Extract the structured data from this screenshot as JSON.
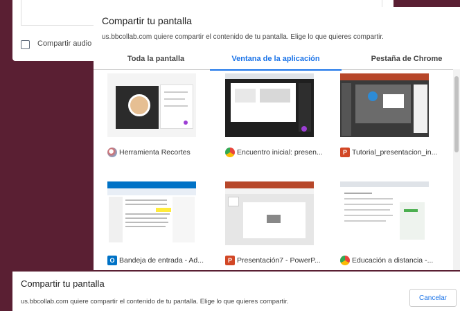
{
  "back_dialog": {
    "audio_label": "Compartir audio"
  },
  "picker": {
    "title": "Compartir tu pantalla",
    "subtitle": "us.bbcollab.com quiere compartir el contenido de tu pantalla. Elige lo que quieres compartir.",
    "tabs": [
      {
        "label": "Toda la pantalla",
        "active": false
      },
      {
        "label": "Ventana de la aplicación",
        "active": true
      },
      {
        "label": "Pestaña de Chrome",
        "active": false
      }
    ],
    "windows": [
      {
        "label": "Herramienta Recortes",
        "icon": "snipping-tool-icon",
        "icon_color": "#d46a6a"
      },
      {
        "label": "Encuentro inicial: presen...",
        "icon": "chrome-icon",
        "icon_color": "#e8453c"
      },
      {
        "label": "Tutorial_presentacion_in...",
        "icon": "powerpoint-icon",
        "icon_color": "#d24726"
      },
      {
        "label": "Bandeja de entrada - Ad...",
        "icon": "outlook-icon",
        "icon_color": "#0072c6"
      },
      {
        "label": "Presentación7 - PowerP...",
        "icon": "powerpoint-icon",
        "icon_color": "#d24726"
      },
      {
        "label": "Educación a distancia -...",
        "icon": "chrome-icon",
        "icon_color": "#e8453c"
      }
    ]
  },
  "bottom_bar": {
    "title": "Compartir tu pantalla",
    "subtitle": "us.bbcollab.com quiere compartir el contenido de tu pantalla. Elige lo que quieres compartir.",
    "cancel_label": "Cancelar"
  },
  "colors": {
    "background": "#5a1f33",
    "accent": "#1a73e8"
  }
}
